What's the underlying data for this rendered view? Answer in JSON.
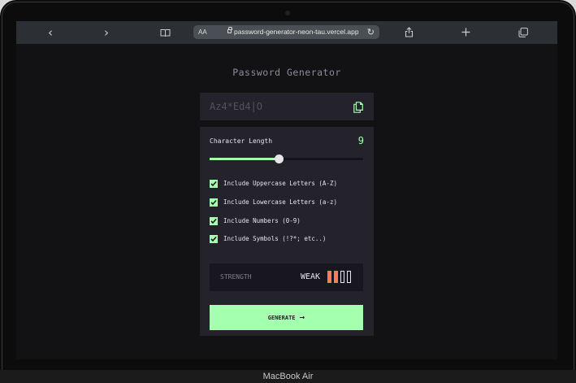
{
  "device": {
    "label": "MacBook Air"
  },
  "browser": {
    "text_size": "AA",
    "url": "password-generator-neon-tau.vercel.app",
    "icons": [
      "back-icon",
      "forward-icon",
      "reader-icon",
      "lock-icon",
      "reload-icon",
      "share-icon",
      "new-tab-icon",
      "tabs-icon"
    ]
  },
  "app": {
    "title": "Password Generator",
    "password": "Az4*Ed4|O",
    "length_label": "Character Length",
    "length_value": "9",
    "slider_value_fraction": 0.45,
    "options": [
      {
        "label": "Include Uppercase Letters (A-Z)",
        "checked": true
      },
      {
        "label": "Include Lowercase Letters (a-z)",
        "checked": true
      },
      {
        "label": "Include Numbers (0-9)",
        "checked": true
      },
      {
        "label": "Include Symbols (!?*; etc..)",
        "checked": true
      }
    ],
    "strength_label": "STRENGTH",
    "strength_value": "WEAK",
    "strength_bars_filled": 2,
    "strength_bars_total": 4,
    "generate_label": "GENERATE"
  },
  "colors": {
    "accent": "#a4ffaf",
    "weak": "#fb7c58",
    "panel": "#24232c",
    "bg": "#121214"
  }
}
